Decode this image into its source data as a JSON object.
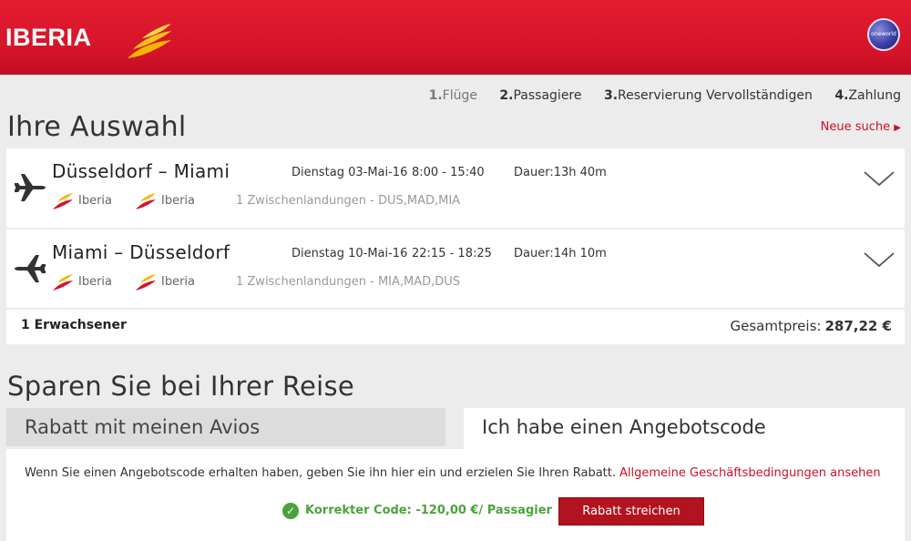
{
  "brand": {
    "name": "IBERIA",
    "alliance": "oneworld",
    "accent": "#d4142a"
  },
  "steps": [
    {
      "num": "1.",
      "label": "Flüge"
    },
    {
      "num": "2.",
      "label": "Passagiere"
    },
    {
      "num": "3.",
      "label": "Reservierung Vervollständigen"
    },
    {
      "num": "4.",
      "label": "Zahlung"
    }
  ],
  "selection": {
    "title": "Ihre Auswahl",
    "new_search": "Neue suche",
    "flights": [
      {
        "route": "Düsseldorf – Miami",
        "date": "Dienstag 03-Mai-16",
        "times": "8:00 - 15:40",
        "duration": "Dauer:13h 40m",
        "carriers": [
          "Iberia",
          "Iberia"
        ],
        "stops": "1 Zwischenlandungen - DUS,MAD,MIA"
      },
      {
        "route": "Miami – Düsseldorf",
        "date": "Dienstag 10-Mai-16",
        "times": "22:15 - 18:25",
        "duration": "Dauer:14h 10m",
        "carriers": [
          "Iberia",
          "Iberia"
        ],
        "stops": "1 Zwischenlandungen - MIA,MAD,DUS"
      }
    ],
    "passengers": "1 Erwachsener",
    "total_label": "Gesamtpreis:",
    "total_value": "287,22 €"
  },
  "savings": {
    "title": "Sparen Sie bei Ihrer Reise",
    "tabs": [
      "Rabatt mit meinen Avios",
      "Ich habe einen Angebotscode"
    ],
    "info_text": "Wenn Sie einen Angebotscode erhalten haben, geben Sie ihn hier ein und erzielen Sie Ihren Rabatt.",
    "terms_link": "Allgemeine Geschäftsbedingungen ansehen",
    "status": "Korrekter Code: -120,00 €/ Passagier",
    "remove_button": "Rabatt streichen"
  }
}
